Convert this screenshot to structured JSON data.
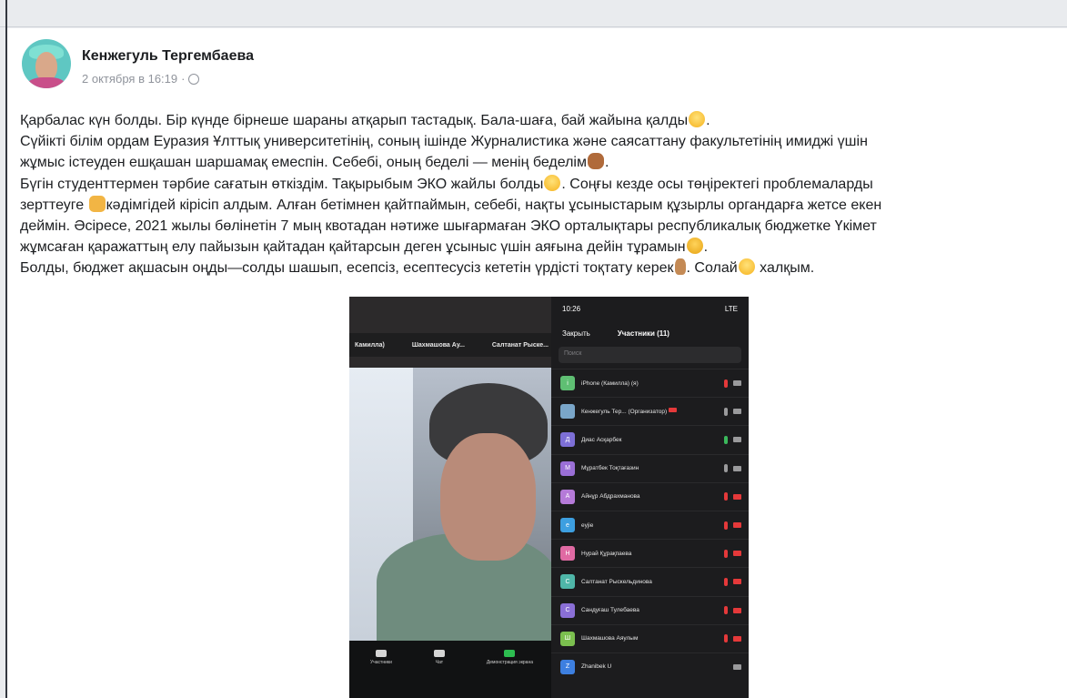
{
  "post": {
    "author": "Кенжегуль Тергембаева",
    "timestamp": "2 октября в 16:19",
    "meta_separator": "·",
    "lines": [
      {
        "text": "Қарбалас күн болды. Бір күнде бірнеше шараны атқарып тастадық. Бала-шаға, бай жайына қалды",
        "emoji": "smile",
        "after": "."
      },
      {
        "text": "Сүйікті білім ордам Еуразия Ұлттық университетінің, соның ішінде Журналистика және саясаттану факультетінің имиджі үшін",
        "emoji": "",
        "after": ""
      },
      {
        "text": "жұмыс істеуден ешқашан шаршамақ емеспін. Себебі, оның беделі — менің беделім",
        "emoji": "fist",
        "after": "."
      },
      {
        "text": "Бүгін студенттермен тәрбие сағатын өткіздім. Тақырыбым ЭКО жайлы болды",
        "emoji": "smile",
        "after": ". Соңғы кезде осы төңіректегі проблемаларды"
      },
      {
        "text": "зерттеуге",
        "emoji": "detective",
        "after": "кәдімгідей кірісіп алдым. Алған бетімнен қайтпаймын, себебі, нақты ұсыныстарым құзырлы органдарға жетсе екен"
      },
      {
        "text": "деймін. Әсіресе, 2021 жылы бөлінетін 7 мың квотадан нәтиже шығармаған ЭКО орталықтары республикалық бюджетке Үкімет",
        "emoji": "",
        "after": ""
      },
      {
        "text": "жұмсаған қаражаттың елу пайызын қайтадан қайтарсын деген ұсыныс үшін аяғына дейін тұрамын",
        "emoji": "cool",
        "after": "."
      },
      {
        "text": "Болды, бюджет ақшасын оңды—солды шашып, есепсіз, есептесусіз кететін үрдісті тоқтату керек",
        "emoji": "finger",
        "after": ". Солай"
      },
      {
        "text": "",
        "emoji": "",
        "after": ""
      }
    ],
    "last_line_tail_emoji": "smile",
    "last_line_tail": " халқым."
  },
  "zoom_left": {
    "names": [
      "Камилла)",
      "Шахмашова Ау...",
      "Салтанат Рыске..."
    ],
    "toolbar": [
      "Участники",
      "Чат",
      "Демонстрация экрана",
      ""
    ]
  },
  "zoom_right": {
    "time": "10:26",
    "signal": "LTE",
    "close_label": "Закрыть",
    "title": "Участники (11)",
    "search_placeholder": "Поиск",
    "participants": [
      {
        "initial": "i",
        "name": "iPhone (Камилла) (я)",
        "color": "#5fbf73",
        "mic": "red",
        "cam": "gray"
      },
      {
        "initial": "",
        "name": "Кенжегуль Тер... (Организатор)",
        "color": "#7aa6c9",
        "mic": "gray",
        "cam": "gray",
        "host": true
      },
      {
        "initial": "Д",
        "name": "Диас Асқарбек",
        "color": "#7d6fd6",
        "mic": "green",
        "cam": "gray"
      },
      {
        "initial": "М",
        "name": "Мұратбек Тоқтағазин",
        "color": "#9a6fd6",
        "mic": "gray",
        "cam": "gray"
      },
      {
        "initial": "А",
        "name": "Айнұр Абдрахманова",
        "color": "#b57ad8",
        "mic": "red",
        "cam": "red"
      },
      {
        "initial": "е",
        "name": "eyjie",
        "color": "#3d9fe0",
        "mic": "red",
        "cam": "red"
      },
      {
        "initial": "Н",
        "name": "Нурай Құрақпаева",
        "color": "#e06aa3",
        "mic": "red",
        "cam": "red"
      },
      {
        "initial": "С",
        "name": "Салтанат Рыскельдинова",
        "color": "#4fb6a8",
        "mic": "red",
        "cam": "red"
      },
      {
        "initial": "С",
        "name": "Сандуғаш Тулебаева",
        "color": "#8a6fd6",
        "mic": "red",
        "cam": "red"
      },
      {
        "initial": "Ш",
        "name": "Шахмашова Аяулым",
        "color": "#7bbf4f",
        "mic": "red",
        "cam": "red"
      },
      {
        "initial": "Z",
        "name": "Zhanibek U",
        "color": "#3d7fe0",
        "mic": "none",
        "cam": "gray"
      }
    ]
  }
}
